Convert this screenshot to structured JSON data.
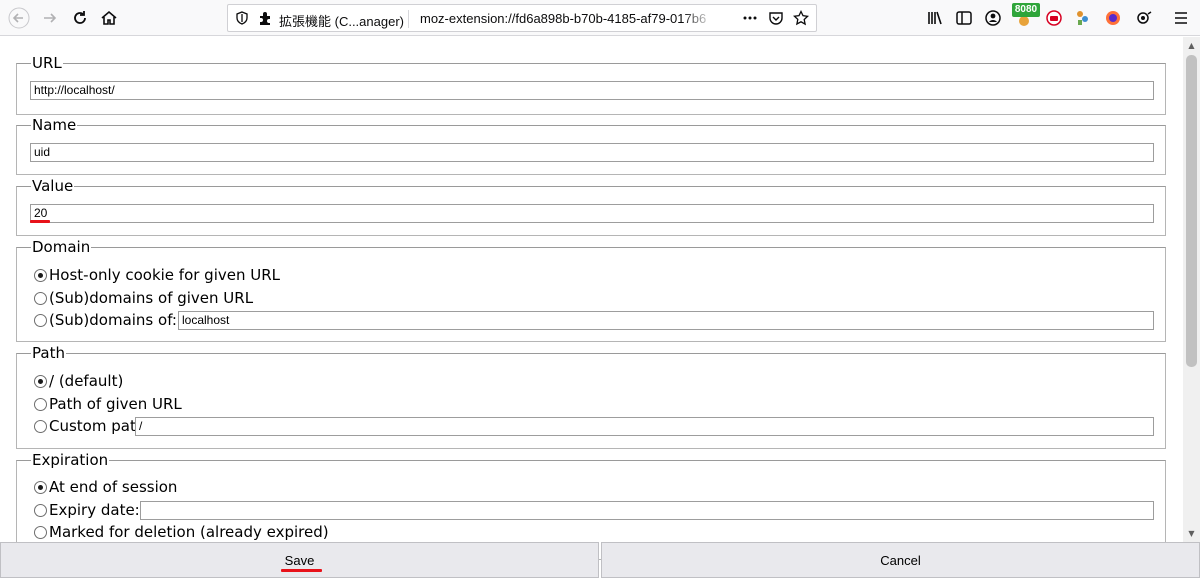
{
  "browser": {
    "tab_title": "拡張機能 (C...anager)",
    "url": "moz-extension://fd6a898b-b70b-4185-af79-017b6",
    "badge_text": "8080"
  },
  "form": {
    "url": {
      "legend": "URL",
      "value": "http://localhost/"
    },
    "name": {
      "legend": "Name",
      "value": "uid"
    },
    "value": {
      "legend": "Value",
      "value": "20"
    },
    "domain": {
      "legend": "Domain",
      "options": [
        "Host-only cookie for given URL",
        "(Sub)domains of given URL",
        "(Sub)domains of:"
      ],
      "selected": 0,
      "custom_value": "localhost"
    },
    "path": {
      "legend": "Path",
      "options": [
        "/ (default)",
        "Path of given URL",
        "Custom path:"
      ],
      "selected": 0,
      "custom_value": "/"
    },
    "expiration": {
      "legend": "Expiration",
      "options": [
        "At end of session",
        "Expiry date:",
        "Marked for deletion (already expired)"
      ],
      "selected": 0,
      "expiry_value": ""
    }
  },
  "buttons": {
    "save": "Save",
    "cancel": "Cancel"
  },
  "colors": {
    "highlight_underline": "#e8121a",
    "badge": "#2fa53a"
  }
}
